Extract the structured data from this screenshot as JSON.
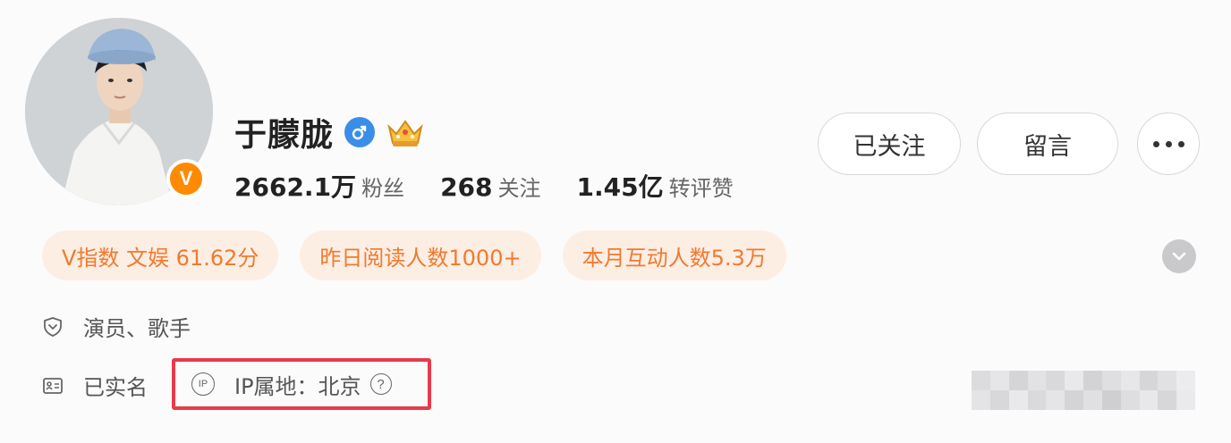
{
  "profile": {
    "name": "于朦胧",
    "verify_mark": "V",
    "gender_icon": "male-icon",
    "badge_icon": "crown-icon"
  },
  "stats": [
    {
      "value": "2662.1万",
      "label": "粉丝"
    },
    {
      "value": "268",
      "label": "关注"
    },
    {
      "value": "1.45亿",
      "label": "转评赞"
    }
  ],
  "actions": {
    "follow_label": "已关注",
    "message_label": "留言",
    "more_icon": "more-dots-icon"
  },
  "tags": [
    "V指数 文娱 61.62分",
    "昨日阅读人数1000+",
    "本月互动人数5.3万"
  ],
  "info": {
    "occupation": "演员、歌手",
    "realname": "已实名",
    "ip_icon_text": "IP",
    "ip_location": "IP属地：北京",
    "help_mark": "?"
  },
  "colors": {
    "accent_orange": "#f07a2e",
    "tag_bg": "#fdeee4",
    "highlight_red": "#e83a4a",
    "gender_blue": "#3b8ee8"
  }
}
